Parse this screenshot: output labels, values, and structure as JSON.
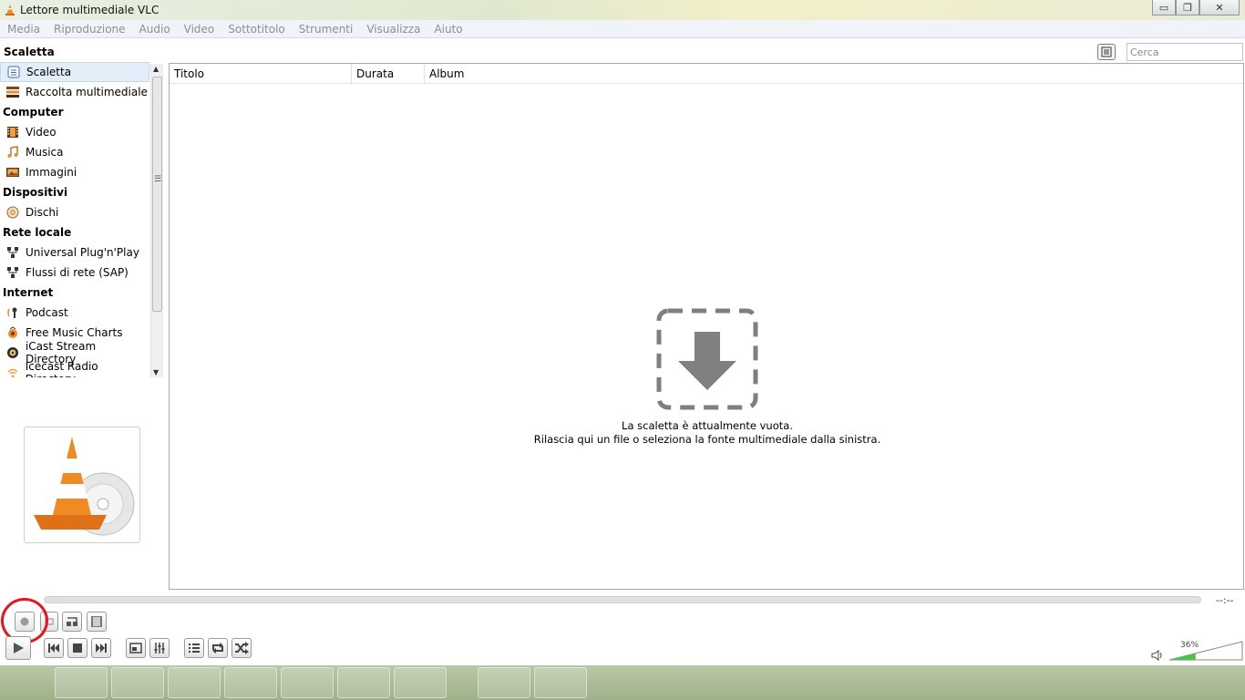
{
  "window": {
    "title": "Lettore multimediale VLC",
    "controls": {
      "minimize": "▭",
      "maximize": "❐",
      "close": "✕"
    }
  },
  "menu": [
    "Media",
    "Riproduzione",
    "Audio",
    "Video",
    "Sottotitolo",
    "Strumenti",
    "Visualizza",
    "Aiuto"
  ],
  "sidebar": {
    "heading": "Scaletta",
    "items": [
      {
        "label": "Scaletta",
        "type": "item",
        "icon": "playlist-icon",
        "selected": true
      },
      {
        "label": "Raccolta multimediale",
        "type": "item",
        "icon": "library-icon"
      },
      {
        "label": "Computer",
        "type": "category"
      },
      {
        "label": "Video",
        "type": "item",
        "icon": "film-icon"
      },
      {
        "label": "Musica",
        "type": "item",
        "icon": "music-note-icon"
      },
      {
        "label": "Immagini",
        "type": "item",
        "icon": "image-icon"
      },
      {
        "label": "Dispositivi",
        "type": "category"
      },
      {
        "label": "Dischi",
        "type": "item",
        "icon": "disc-icon"
      },
      {
        "label": "Rete locale",
        "type": "category"
      },
      {
        "label": "Universal Plug'n'Play",
        "type": "item",
        "icon": "network-icon"
      },
      {
        "label": "Flussi di rete (SAP)",
        "type": "item",
        "icon": "network-icon"
      },
      {
        "label": "Internet",
        "type": "category"
      },
      {
        "label": "Podcast",
        "type": "item",
        "icon": "podcast-icon"
      },
      {
        "label": "Free Music Charts",
        "type": "item",
        "icon": "charts-icon"
      },
      {
        "label": "iCast Stream Directory",
        "type": "item",
        "icon": "globe-icon"
      },
      {
        "label": "Icecast Radio Directory",
        "type": "item",
        "icon": "radio-icon"
      }
    ]
  },
  "search": {
    "placeholder": "Cerca"
  },
  "playlist": {
    "columns": [
      "Titolo",
      "Durata",
      "Album"
    ],
    "empty_line1": "La scaletta è attualmente vuota.",
    "empty_line2": "Rilascia qui un file o seleziona la fonte multimediale dalla sinistra."
  },
  "player": {
    "time": "--:--",
    "volume": "36%",
    "volume_level": 0.36
  },
  "colors": {
    "accent_orange": "#f08a24",
    "highlight_red": "#e8141c"
  }
}
